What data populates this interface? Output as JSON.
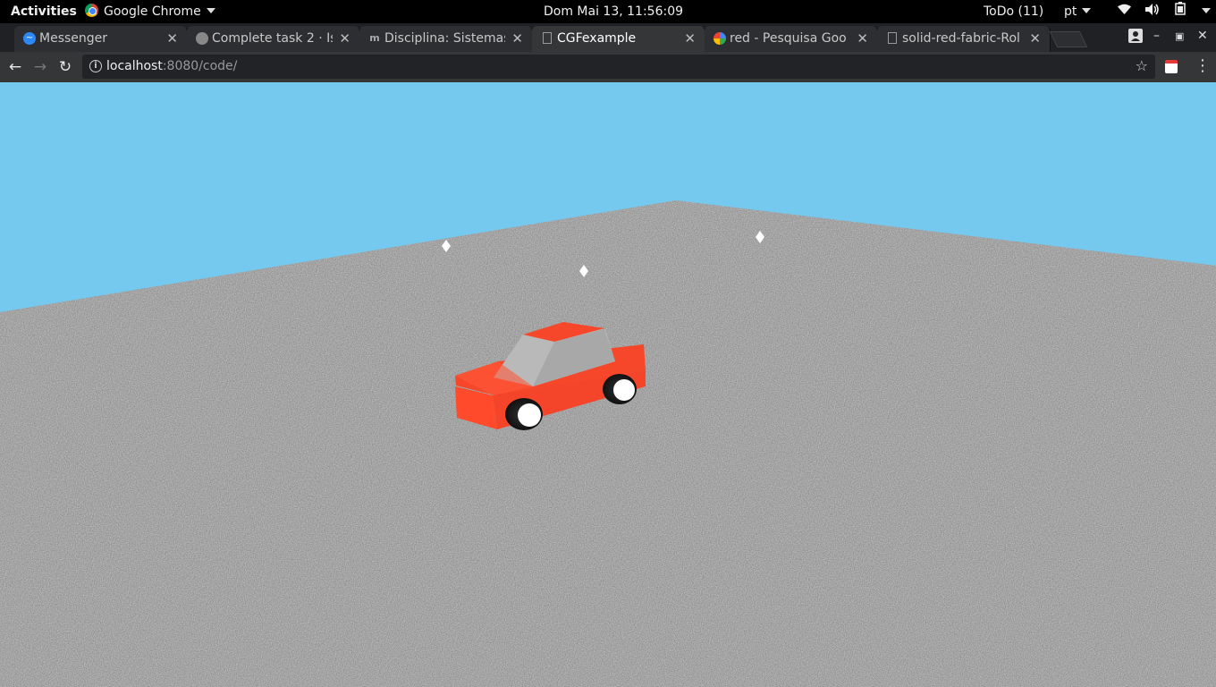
{
  "system_bar": {
    "activities": "Activities",
    "app_name": "Google Chrome",
    "clock": "Dom Mai 13, 11:56:09",
    "todo": "ToDo (11)",
    "language": "pt",
    "icons": [
      "wifi-icon",
      "volume-icon",
      "battery-icon",
      "power-menu-icon"
    ]
  },
  "tabs": [
    {
      "title": "Messenger",
      "icon": "messenger-icon",
      "active": false
    },
    {
      "title": "Complete task 2 · Is",
      "icon": "github-icon",
      "active": false
    },
    {
      "title": "Disciplina: Sistemas",
      "icon": "moodle-icon",
      "active": false
    },
    {
      "title": "CGFexample",
      "icon": "page-icon",
      "active": true
    },
    {
      "title": "red - Pesquisa Goo",
      "icon": "google-icon",
      "active": false
    },
    {
      "title": "solid-red-fabric-Rol",
      "icon": "page-icon",
      "active": false
    }
  ],
  "toolbar": {
    "url_host": "localhost",
    "url_rest": ":8080/code/"
  },
  "scene": {
    "sky_color": "#76c9ee",
    "ground_color": "#8a8a8a",
    "car_body_color": "#f7472a",
    "car_window_color": "#b9b9b9",
    "lights": 3
  }
}
